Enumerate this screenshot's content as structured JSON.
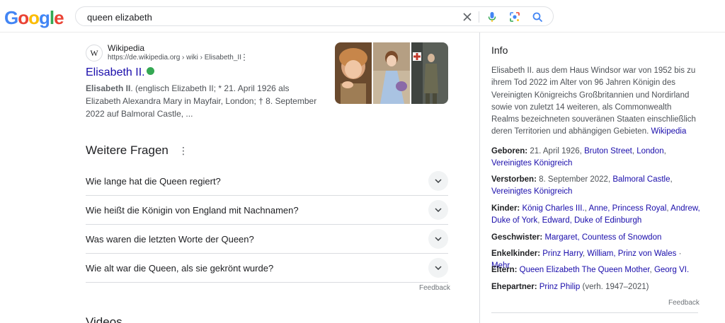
{
  "search": {
    "query": "queen elizabeth"
  },
  "logo": {
    "letters": [
      "G",
      "o",
      "o",
      "g",
      "l",
      "e"
    ],
    "colors": [
      "#4285f4",
      "#ea4335",
      "#fbbc05",
      "#4285f4",
      "#34a853",
      "#ea4335"
    ]
  },
  "icons": {
    "clear": "close-icon",
    "voice": "microphone-icon",
    "lens": "camera-lens-icon",
    "search": "search-icon"
  },
  "result": {
    "favicon": "W",
    "site_name": "Wikipedia",
    "url": "https://de.wikipedia.org › wiki › Elisabeth_II",
    "title": "Elisabeth II.",
    "snippet_bold": "Elisabeth II",
    "snippet_rest": ". (englisch Elizabeth II; * 21. April 1926 als Elizabeth Alexandra Mary in Mayfair, London; † 8. September 2022 auf Balmoral Castle, ..."
  },
  "paa": {
    "title": "Weitere Fragen",
    "questions": [
      "Wie lange hat die Queen regiert?",
      "Wie heißt die Königin von England mit Nachnamen?",
      "Was waren die letzten Worte der Queen?",
      "Wie alt war die Queen, als sie gekrönt wurde?"
    ],
    "feedback": "Feedback"
  },
  "videos_title": "Videos",
  "kp": {
    "title": "Info",
    "description": "Elisabeth II. aus dem Haus Windsor war von 1952 bis zu ihrem Tod 2022 im Alter von 96 Jahren Königin des Vereinigten Königreichs Großbritannien und Nordirland sowie von zuletzt 14 weiteren, als Commonwealth Realms bezeichneten souveränen Staaten einschließlich deren Territorien und abhängigen Gebieten.",
    "source_link": "Wikipedia",
    "facts": {
      "born_label": "Geboren:",
      "born_text": "21. April 1926,",
      "born_links": [
        "Bruton Street",
        "London",
        "Vereinigtes Königreich"
      ],
      "died_label": "Verstorben:",
      "died_text": "8. September 2022,",
      "died_links": [
        "Balmoral Castle",
        "Vereinigtes Königreich"
      ],
      "children_label": "Kinder:",
      "children_links": [
        "König Charles III.",
        "Anne, Princess Royal",
        "Andrew, Duke of York",
        "Edward, Duke of Edinburgh"
      ],
      "siblings_label": "Geschwister:",
      "siblings_link": "Margaret, Countess of Snowdon",
      "grandchildren_label": "Enkelkinder:",
      "grandchildren_links": [
        "Prinz Harry",
        "William, Prinz von Wales"
      ],
      "grandchildren_more": "Mehr",
      "parents_label": "Eltern:",
      "parents_links": [
        "Queen Elizabeth The Queen Mother",
        "Georg VI."
      ],
      "spouse_label": "Ehepartner:",
      "spouse_link": "Prinz Philip",
      "spouse_note": "(verh. 1947–2021)"
    },
    "feedback": "Feedback"
  }
}
